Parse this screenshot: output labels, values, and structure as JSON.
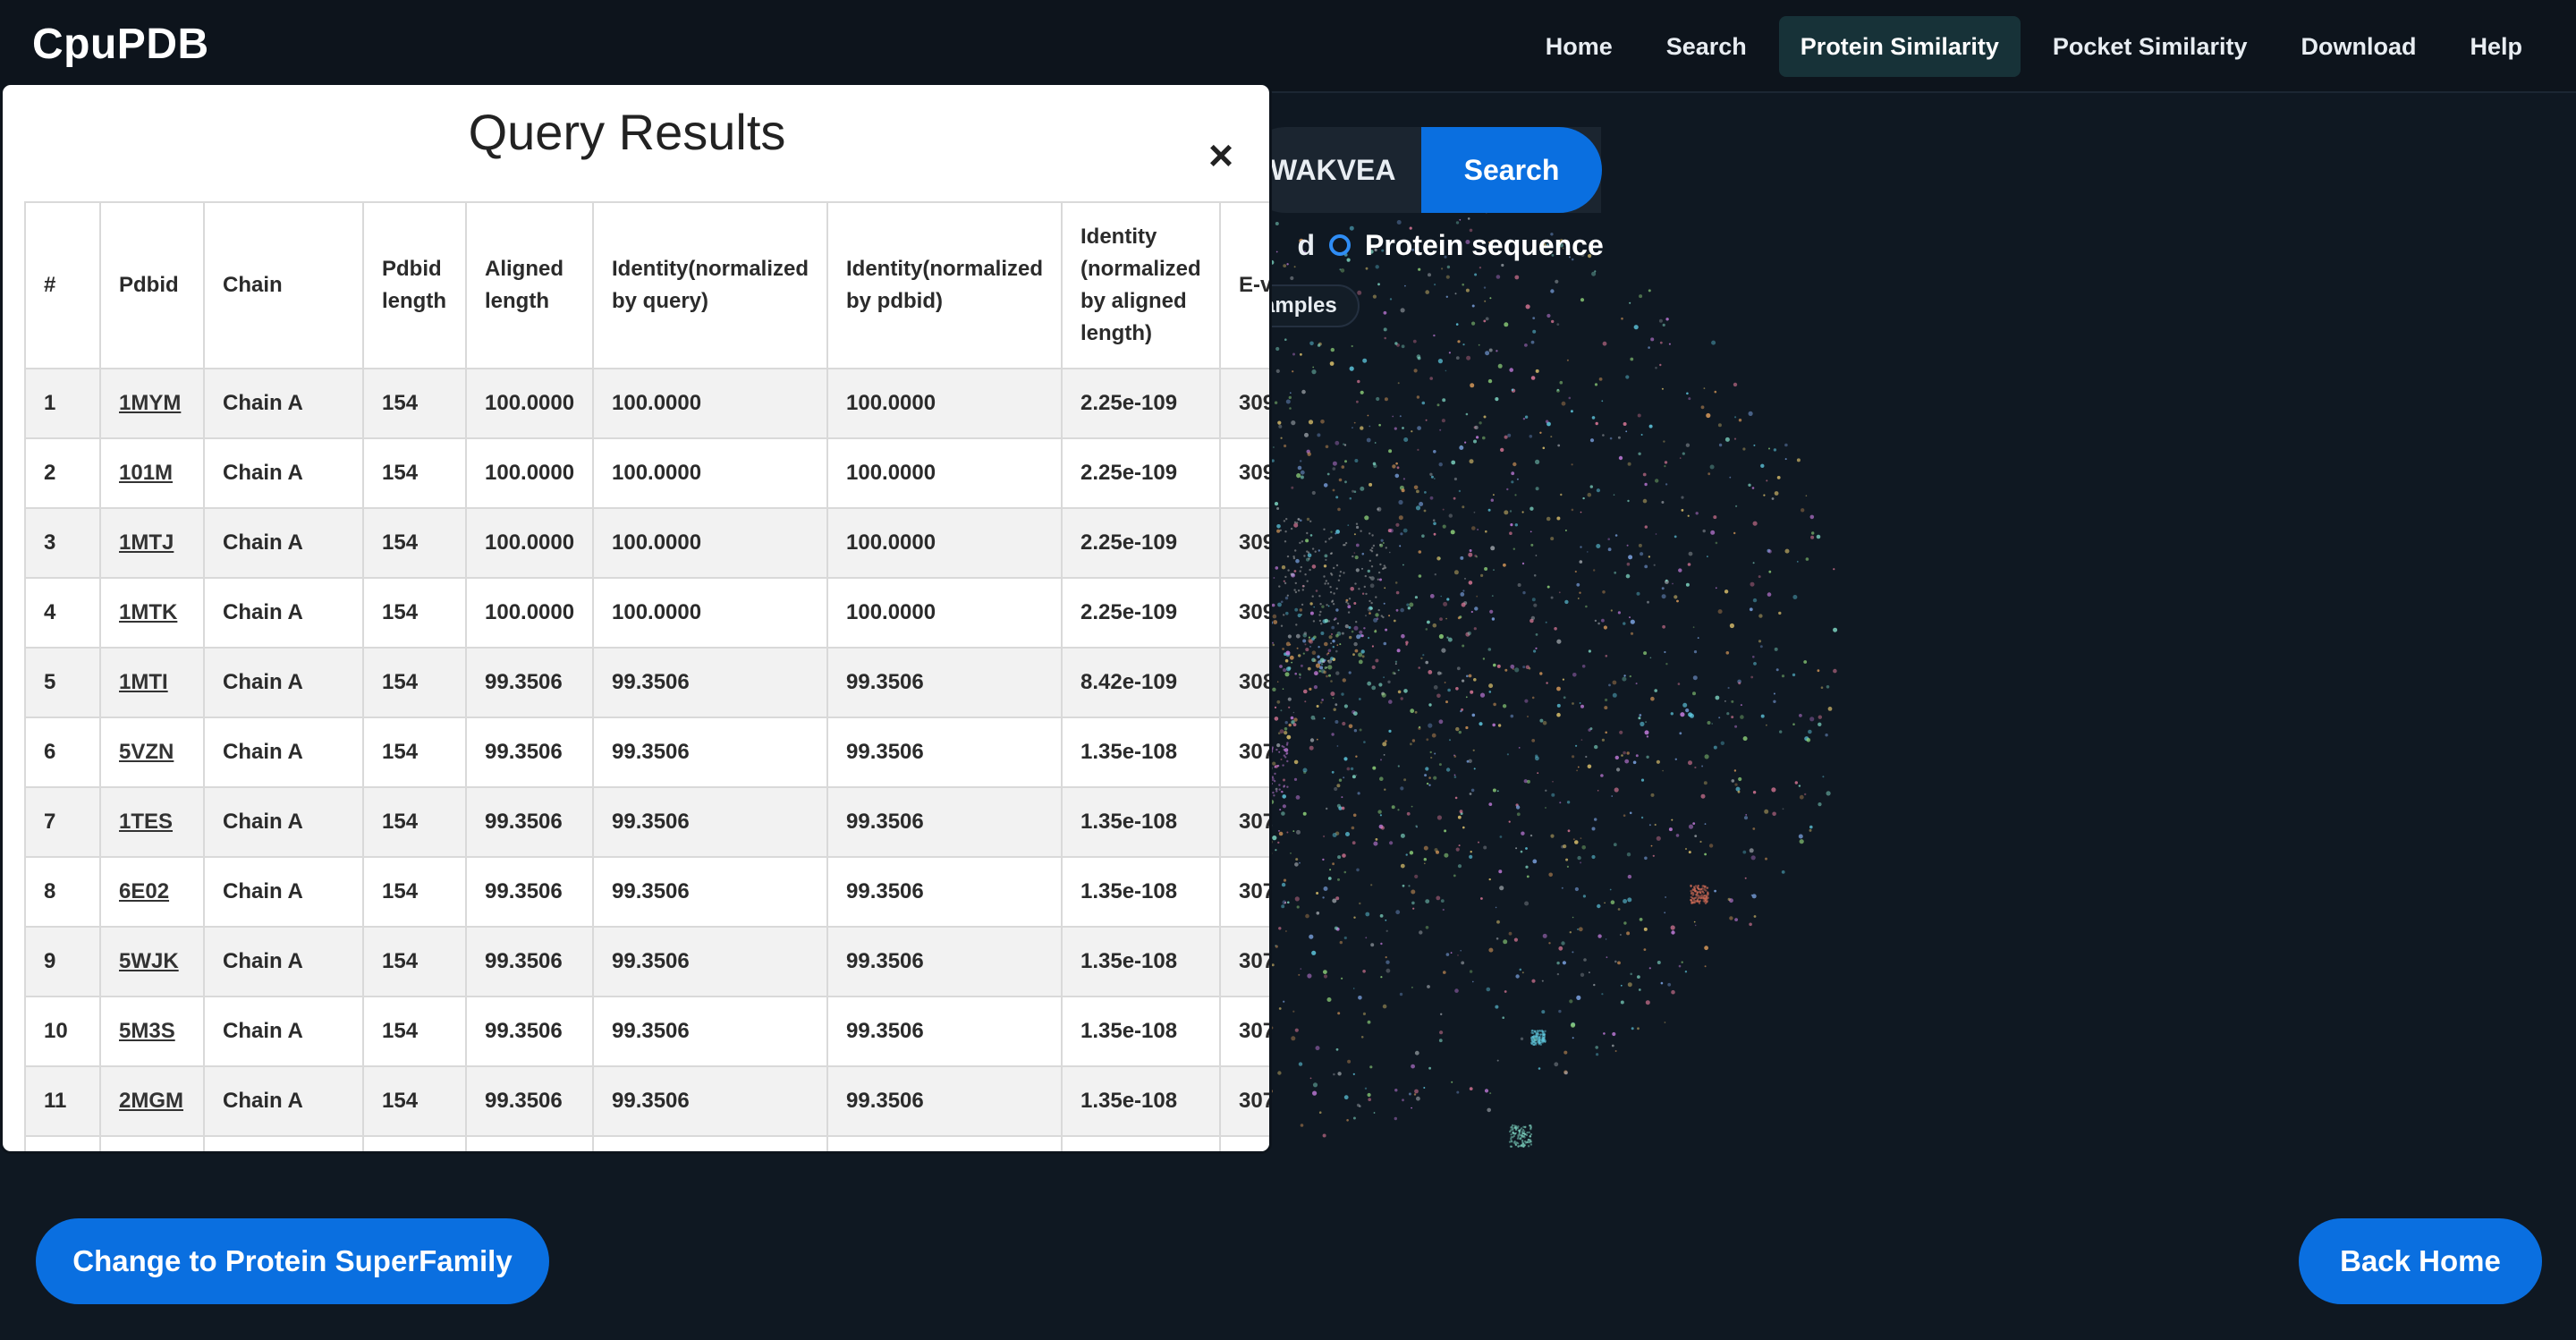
{
  "navbar": {
    "brand": "CpuPDB",
    "links": [
      "Home",
      "Search",
      "Protein Similarity",
      "Pocket Similarity",
      "Download",
      "Help"
    ],
    "active": "Protein Similarity"
  },
  "search": {
    "value": "WAKVEA",
    "button_label": "Search",
    "option_a_partial": "d",
    "option_b": "Protein sequence",
    "examples_partial": "amples"
  },
  "modal": {
    "title": "Query Results",
    "close": "×",
    "columns": [
      "#",
      "Pdbid",
      "Chain",
      "Pdbid length",
      "Aligned length",
      "Identity(normalized by query)",
      "Identity(normalized by pdbid)",
      "Identity (normalized by aligned length)",
      "E-value"
    ],
    "rows": [
      [
        "1",
        "1MYM",
        "Chain A",
        "154",
        "100.0000",
        "100.0000",
        "100.0000",
        "2.25e-109",
        "309"
      ],
      [
        "2",
        "101M",
        "Chain A",
        "154",
        "100.0000",
        "100.0000",
        "100.0000",
        "2.25e-109",
        "309"
      ],
      [
        "3",
        "1MTJ",
        "Chain A",
        "154",
        "100.0000",
        "100.0000",
        "100.0000",
        "2.25e-109",
        "309"
      ],
      [
        "4",
        "1MTK",
        "Chain A",
        "154",
        "100.0000",
        "100.0000",
        "100.0000",
        "2.25e-109",
        "309"
      ],
      [
        "5",
        "1MTI",
        "Chain A",
        "154",
        "99.3506",
        "99.3506",
        "99.3506",
        "8.42e-109",
        "308"
      ],
      [
        "6",
        "5VZN",
        "Chain A",
        "154",
        "99.3506",
        "99.3506",
        "99.3506",
        "1.35e-108",
        "307"
      ],
      [
        "7",
        "1TES",
        "Chain A",
        "154",
        "99.3506",
        "99.3506",
        "99.3506",
        "1.35e-108",
        "307"
      ],
      [
        "8",
        "6E02",
        "Chain A",
        "154",
        "99.3506",
        "99.3506",
        "99.3506",
        "1.35e-108",
        "307"
      ],
      [
        "9",
        "5WJK",
        "Chain A",
        "154",
        "99.3506",
        "99.3506",
        "99.3506",
        "1.35e-108",
        "307"
      ],
      [
        "10",
        "5M3S",
        "Chain A",
        "154",
        "99.3506",
        "99.3506",
        "99.3506",
        "1.35e-108",
        "307"
      ],
      [
        "11",
        "2MGM",
        "Chain A",
        "154",
        "99.3506",
        "99.3506",
        "99.3506",
        "1.35e-108",
        "307"
      ],
      [
        "",
        "",
        "",
        "",
        "",
        "",
        "",
        "",
        ""
      ]
    ]
  },
  "buttons": {
    "change": "Change to Protein SuperFamily",
    "back_home": "Back Home"
  },
  "colors": {
    "background": "#0f1822",
    "primary": "#0a6fe0",
    "nav_active": "#173238"
  }
}
